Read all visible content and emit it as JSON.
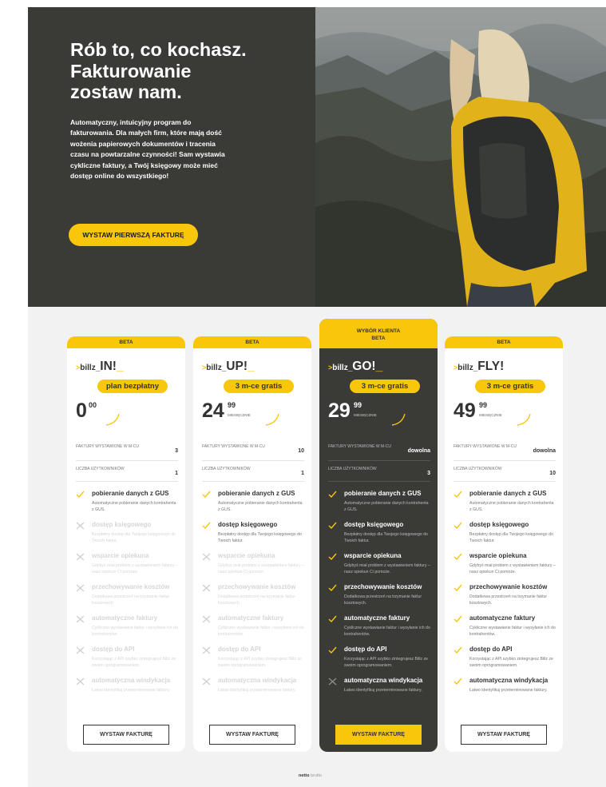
{
  "hero": {
    "title": "Rób to, co kochasz.\nFakturowanie\nzostaw nam.",
    "description": "Automatyczny, intuicyjny program do fakturowania. Dla małych firm, które mają dość wożenia papierowych dokumentów i tracenia czasu na powtarzalne czynności! Sam wystawia cykliczne faktury, a Twój księgowy może mieć dostęp online do wszystkiego!",
    "cta_label": "WYSTAW PIERWSZĄ FAKTURĘ",
    "photo": "hiker-with-backpack-mountains-photo"
  },
  "colors": {
    "accent": "#f8c60b",
    "dark": "#3a3a37",
    "page_bg": "#f2f2f2"
  },
  "plans": [
    {
      "top_label": "BETA",
      "brand_gt": ">",
      "brand_prefix": "billz_",
      "brand_name": "IN!",
      "brand_underscore": "_",
      "badge": "plan bezpłatny",
      "price_int": "0",
      "price_dec": "00",
      "price_period": "",
      "stat1_label": "FAKTURY WYSTAWIONE W M-CU",
      "stat1_value": "3",
      "stat2_label": "LICZBA UŻYTKOWNIKÓW",
      "stat2_value": "1",
      "features": [
        {
          "title": "pobieranie danych z GUS",
          "desc": "Automatyczne pobieranie danych kontrahenta z GUS.",
          "enabled": true
        },
        {
          "title": "dostęp księgowego",
          "desc": "Bezpłatny dostęp dla Twojego księgowego do Twoich faktur.",
          "enabled": false
        },
        {
          "title": "wsparcie opiekuna",
          "desc": "Gdybyś miał problem z wystawieniem faktury – nasz opiekun Ci pomoże.",
          "enabled": false
        },
        {
          "title": "przechowywanie kosztów",
          "desc": "Dodatkowa przestrzeń na trzymanie faktur kosztowych.",
          "enabled": false
        },
        {
          "title": "automatyczne faktury",
          "desc": "Cykliczne wystawianie faktur i wysyłanie ich do kontrahentów.",
          "enabled": false
        },
        {
          "title": "dostęp do API",
          "desc": "Korzystając z API szybko zintegrujesz Billz ze swoim oprogramowaniem.",
          "enabled": false
        },
        {
          "title": "automatyczna windykacja",
          "desc": "Łatwo identyfikuj przeterminowane faktury.",
          "enabled": false
        }
      ],
      "button": "WYSTAW FAKTURĘ"
    },
    {
      "top_label": "BETA",
      "brand_gt": ">",
      "brand_prefix": "billz_",
      "brand_name": "UP!",
      "brand_underscore": "_",
      "badge": "3 m-ce gratis",
      "price_int": "24",
      "price_dec": "99",
      "price_period": "MIESIĘCZNIE",
      "stat1_label": "FAKTURY WYSTAWIONE W M-CU",
      "stat1_value": "10",
      "stat2_label": "LICZBA UŻYTKOWNIKÓW",
      "stat2_value": "1",
      "features": [
        {
          "title": "pobieranie danych z GUS",
          "desc": "Automatyczne pobieranie danych kontrahenta z GUS.",
          "enabled": true
        },
        {
          "title": "dostęp księgowego",
          "desc": "Bezpłatny dostęp dla Twojego księgowego do Twoich faktur.",
          "enabled": true
        },
        {
          "title": "wsparcie opiekuna",
          "desc": "Gdybyś miał problem z wystawieniem faktury – nasz opiekun Ci pomoże.",
          "enabled": false
        },
        {
          "title": "przechowywanie kosztów",
          "desc": "Dodatkowa przestrzeń na trzymanie faktur kosztowych.",
          "enabled": false
        },
        {
          "title": "automatyczne faktury",
          "desc": "Cykliczne wystawianie faktur i wysyłanie ich do kontrahentów.",
          "enabled": false
        },
        {
          "title": "dostęp do API",
          "desc": "Korzystając z API szybko zintegrujesz Billz ze swoim oprogramowaniem.",
          "enabled": false
        },
        {
          "title": "automatyczna windykacja",
          "desc": "Łatwo identyfikuj przeterminowane faktury.",
          "enabled": false
        }
      ],
      "button": "WYSTAW FAKTURĘ"
    },
    {
      "top_label_choice": "WYBÓR KLIENTA",
      "top_label": "BETA",
      "brand_gt": ">",
      "brand_prefix": "billz_",
      "brand_name": "GO!",
      "brand_underscore": "_",
      "badge": "3 m-ce gratis",
      "price_int": "29",
      "price_dec": "99",
      "price_period": "MIESIĘCZNIE",
      "stat1_label": "FAKTURY WYSTAWIONE W M-CU",
      "stat1_value": "dowolna",
      "stat2_label": "LICZBA UŻYTKOWNIKÓW",
      "stat2_value": "3",
      "features": [
        {
          "title": "pobieranie danych z GUS",
          "desc": "Automatyczne pobieranie danych kontrahenta z GUS.",
          "enabled": true
        },
        {
          "title": "dostęp księgowego",
          "desc": "Bezpłatny dostęp dla Twojego księgowego do Twoich faktur.",
          "enabled": true
        },
        {
          "title": "wsparcie opiekuna",
          "desc": "Gdybyś miał problem z wystawieniem faktury – nasz opiekun Ci pomoże.",
          "enabled": true
        },
        {
          "title": "przechowywanie kosztów",
          "desc": "Dodatkowa przestrzeń na trzymanie faktur kosztowych.",
          "enabled": true
        },
        {
          "title": "automatyczne faktury",
          "desc": "Cykliczne wystawianie faktur i wysyłanie ich do kontrahentów.",
          "enabled": true
        },
        {
          "title": "dostęp do API",
          "desc": "Korzystając z API szybko zintegrujesz Billz ze swoim oprogramowaniem.",
          "enabled": true
        },
        {
          "title": "automatyczna windykacja",
          "desc": "Łatwo identyfikuj przeterminowane faktury.",
          "enabled": false
        }
      ],
      "button": "WYSTAW FAKTURĘ"
    },
    {
      "top_label": "BETA",
      "brand_gt": ">",
      "brand_prefix": "billz_",
      "brand_name": "FLY!",
      "brand_underscore": "",
      "badge": "3 m-ce gratis",
      "price_int": "49",
      "price_dec": "99",
      "price_period": "MIESIĘCZNIE",
      "stat1_label": "FAKTURY WYSTAWIONE W M-CU",
      "stat1_value": "dowolna",
      "stat2_label": "LICZBA UŻYTKOWNIKÓW",
      "stat2_value": "10",
      "features": [
        {
          "title": "pobieranie danych z GUS",
          "desc": "Automatyczne pobieranie danych kontrahenta z GUS.",
          "enabled": true
        },
        {
          "title": "dostęp księgowego",
          "desc": "Bezpłatny dostęp dla Twojego księgowego do Twoich faktur.",
          "enabled": true
        },
        {
          "title": "wsparcie opiekuna",
          "desc": "Gdybyś miał problem z wystawieniem faktury – nasz opiekun Ci pomoże.",
          "enabled": true
        },
        {
          "title": "przechowywanie kosztów",
          "desc": "Dodatkowa przestrzeń na trzymanie faktur kosztowych.",
          "enabled": true
        },
        {
          "title": "automatyczne faktury",
          "desc": "Cykliczne wystawianie faktur i wysyłanie ich do kontrahentów.",
          "enabled": true
        },
        {
          "title": "dostęp do API",
          "desc": "Korzystając z API szybko zintegrujesz Billz ze swoim oprogramowaniem.",
          "enabled": true
        },
        {
          "title": "automatyczna windykacja",
          "desc": "Łatwo identyfikuj przeterminowane faktury.",
          "enabled": true
        }
      ],
      "button": "WYSTAW FAKTURĘ"
    }
  ],
  "price_toggle": {
    "active": "netto",
    "inactive": "brutto"
  }
}
